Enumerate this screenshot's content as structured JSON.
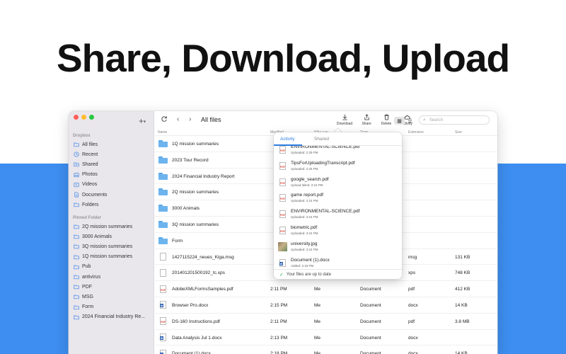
{
  "headline": "Share, Download, Upload",
  "sidebar": {
    "section_dropbox": "Dropbox",
    "dropbox_items": [
      {
        "label": "All files",
        "icon": "folder-icon"
      },
      {
        "label": "Recent",
        "icon": "clock-icon"
      },
      {
        "label": "Shared",
        "icon": "shared-icon"
      },
      {
        "label": "Photos",
        "icon": "photos-icon"
      },
      {
        "label": "Videos",
        "icon": "video-icon"
      },
      {
        "label": "Documents",
        "icon": "document-icon"
      },
      {
        "label": "Folders",
        "icon": "folder-icon"
      }
    ],
    "section_pinned": "Pinned Folder",
    "pinned_items": [
      {
        "label": "2Q mission summaries"
      },
      {
        "label": "3000 Animals"
      },
      {
        "label": "3Q mission summaries"
      },
      {
        "label": "1Q mission summaries"
      },
      {
        "label": "Pub"
      },
      {
        "label": "antivirus"
      },
      {
        "label": "PDF"
      },
      {
        "label": "MSG"
      },
      {
        "label": "Form"
      },
      {
        "label": "2024 Financial Industry Re..."
      }
    ]
  },
  "toolbar": {
    "title": "All files",
    "actions": [
      {
        "label": "Download",
        "icon": "download-icon"
      },
      {
        "label": "Share",
        "icon": "share-icon"
      },
      {
        "label": "Delete",
        "icon": "trash-icon"
      },
      {
        "label": "Activity",
        "icon": "cloud-icon"
      }
    ],
    "search_placeholder": "Search"
  },
  "columns": {
    "name": "Name",
    "modified": "Modified",
    "who": "Who can",
    "type": "Type",
    "extension": "Extension",
    "size": "Size"
  },
  "files": [
    {
      "name": "1Q mission summaries",
      "kind": "folder",
      "modified": "",
      "who": "",
      "type": "",
      "ext": "",
      "size": ""
    },
    {
      "name": "2023 Tour Record",
      "kind": "shared-folder",
      "modified": "",
      "who": "",
      "type": "",
      "ext": "",
      "size": ""
    },
    {
      "name": "2024 Financial Industry Report",
      "kind": "folder",
      "modified": "",
      "who": "",
      "type": "",
      "ext": "",
      "size": ""
    },
    {
      "name": "2Q mission summaries",
      "kind": "folder",
      "modified": "",
      "who": "",
      "type": "",
      "ext": "",
      "size": ""
    },
    {
      "name": "3000 Animals",
      "kind": "folder",
      "modified": "",
      "who": "",
      "type": "",
      "ext": "",
      "size": ""
    },
    {
      "name": "3Q mission summaries",
      "kind": "folder",
      "modified": "",
      "who": "",
      "type": "",
      "ext": "",
      "size": ""
    },
    {
      "name": "Form",
      "kind": "folder",
      "modified": "",
      "who": "",
      "type": "",
      "ext": "",
      "size": ""
    },
    {
      "name": "1427115224_neues_Kiga.msg",
      "kind": "msg",
      "modified": "",
      "who": "",
      "type": "",
      "ext": "msg",
      "size": "131 KB"
    },
    {
      "name": "20140120150019​2_tc.xps",
      "kind": "xps",
      "modified": "",
      "who": "",
      "type": "",
      "ext": "xps",
      "size": "748 KB"
    },
    {
      "name": "AdobeXMLFormsSamples.pdf",
      "kind": "pdf",
      "modified": "2:11 PM",
      "who": "Me",
      "type": "Document",
      "ext": "pdf",
      "size": "412 KB"
    },
    {
      "name": "Browser Pro.docx",
      "kind": "word",
      "modified": "2:15 PM",
      "who": "Me",
      "type": "Document",
      "ext": "docx",
      "size": "14 KB"
    },
    {
      "name": "DS-160 Instructions.pdf",
      "kind": "pdf",
      "modified": "2:11 PM",
      "who": "Me",
      "type": "Document",
      "ext": "pdf",
      "size": "3.8 MB"
    },
    {
      "name": "Data Analysis Jul 1.docx",
      "kind": "word",
      "modified": "2:13 PM",
      "who": "Me",
      "type": "Document",
      "ext": "docx",
      "size": ""
    },
    {
      "name": "Document (1).docx",
      "kind": "word",
      "modified": "2:18 PM",
      "who": "Me",
      "type": "Document",
      "ext": "docx",
      "size": "14 KB"
    }
  ],
  "activity": {
    "tab_activity": "Activity",
    "tab_shared": "Shared",
    "items": [
      {
        "name": "ENVIRONMENTAL-SCIENCE.pdf",
        "status": "Uploaded: 2:25 PM",
        "kind": "pdf"
      },
      {
        "name": "TipsForUploadingTranscript.pdf",
        "status": "Uploaded: 2:25 PM",
        "kind": "pdf"
      },
      {
        "name": "google_search.pdf",
        "status": "Upload failed: 2:24 PM",
        "kind": "pdf"
      },
      {
        "name": "game report.pdf",
        "status": "Uploaded: 2:24 PM",
        "kind": "pdf"
      },
      {
        "name": "ENVIRONMENTAL-SCIENCE.pdf",
        "status": "Uploaded: 2:24 PM",
        "kind": "pdf"
      },
      {
        "name": "biometric.pdf",
        "status": "Uploaded: 2:24 PM",
        "kind": "pdf"
      },
      {
        "name": "university.jpg",
        "status": "Uploaded: 2:24 PM",
        "kind": "image"
      },
      {
        "name": "Document (1).docx",
        "status": "Added: 2:18 PM",
        "kind": "word"
      }
    ],
    "footer": "Your files are up to date"
  },
  "pdf_badge": "PDF"
}
